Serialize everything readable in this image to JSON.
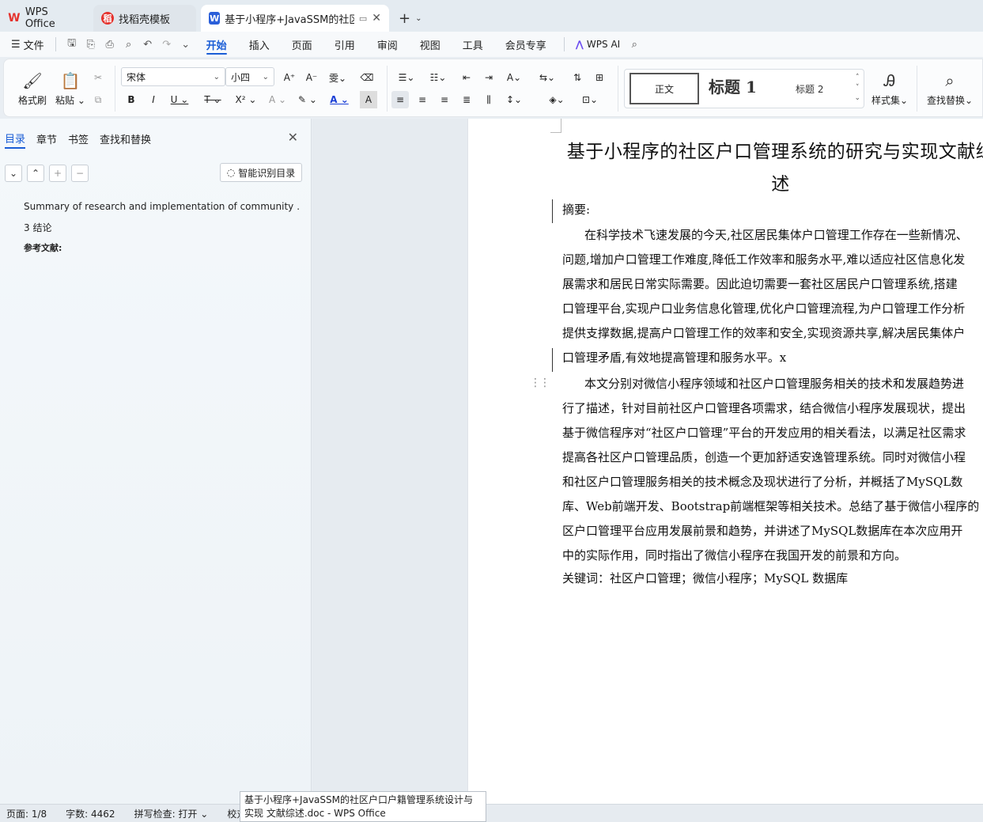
{
  "tabs": [
    {
      "label": "WPS Office",
      "icon": "wps-logo-icon"
    },
    {
      "label": "找稻壳模板",
      "icon": "docer-icon"
    },
    {
      "label": "基于小程序+JavaSSM的社区户",
      "icon": "word-doc-icon",
      "active": true
    }
  ],
  "menu": {
    "file": "文件",
    "items": [
      "开始",
      "插入",
      "页面",
      "引用",
      "审阅",
      "视图",
      "工具",
      "会员专享"
    ],
    "active": "开始",
    "wps_ai": "WPS AI"
  },
  "ribbon": {
    "format_painter": "格式刷",
    "paste": "粘贴",
    "font_name": "宋体",
    "font_size": "小四",
    "styles": {
      "normal": "正文",
      "heading1": "标题 1",
      "heading2": "标题 2"
    },
    "style_set": "样式集",
    "find_replace": "查找替换"
  },
  "nav": {
    "tabs": [
      "目录",
      "章节",
      "书签",
      "查找和替换"
    ],
    "active_tab": "目录",
    "smart_toc": "智能识别目录",
    "toc_items": [
      "Summary of research and implementation of community …",
      "3 结论",
      "参考文献:"
    ]
  },
  "document": {
    "title_line1": "基于小程序的社区户口管理系统的研究与实现文献综",
    "title_line2": "述",
    "abstract_label": "摘要:",
    "para1": [
      "在科学技术飞速发展的今天,社区居民集体户口管理工作存在一些新情况、",
      "问题,增加户口管理工作难度,降低工作效率和服务水平,难以适应社区信息化发",
      "展需求和居民日常实际需要。因此迫切需要一套社区居民户口管理系统,搭建",
      "口管理平台,实现户口业务信息化管理,优化户口管理流程,为户口管理工作分析",
      "提供支撑数据,提高户口管理工作的效率和安全,实现资源共享,解决居民集体户",
      "口管理矛盾,有效地提高管理和服务水平。x"
    ],
    "para2": [
      "本文分别对微信小程序领域和社区户口管理服务相关的技术和发展趋势进",
      "行了描述，针对目前社区户口管理各项需求，结合微信小程序发展现状，提出",
      "基于微信程序对“社区户口管理”平台的开发应用的相关看法，以满足社区需求",
      "提高各社区户口管理品质，创造一个更加舒适安逸管理系统。同时对微信小程",
      "和社区户口管理服务相关的技术概念及现状进行了分析，并概括了MySQL数",
      "库、Web前端开发、Bootstrap前端框架等相关技术。总结了基于微信小程序的",
      "区户口管理平台应用发展前景和趋势，并讲述了MySQL数据库在本次应用开",
      "中的实际作用，同时指出了微信小程序在我国开发的前景和方向。"
    ],
    "keywords": "关键词：社区户口管理；微信小程序；MySQL 数据库"
  },
  "status": {
    "page": "页面: 1/8",
    "words": "字数: 4462",
    "spell": "拼写检查: 打开",
    "proof": "校对"
  },
  "tooltip": "基于小程序+JavaSSM的社区户口户籍管理系统设计与实现 文献综述.doc - WPS Office",
  "colors": {
    "accent": "#1a5dd6",
    "wps_red": "#e5322d",
    "word_blue": "#2b5fd9"
  }
}
